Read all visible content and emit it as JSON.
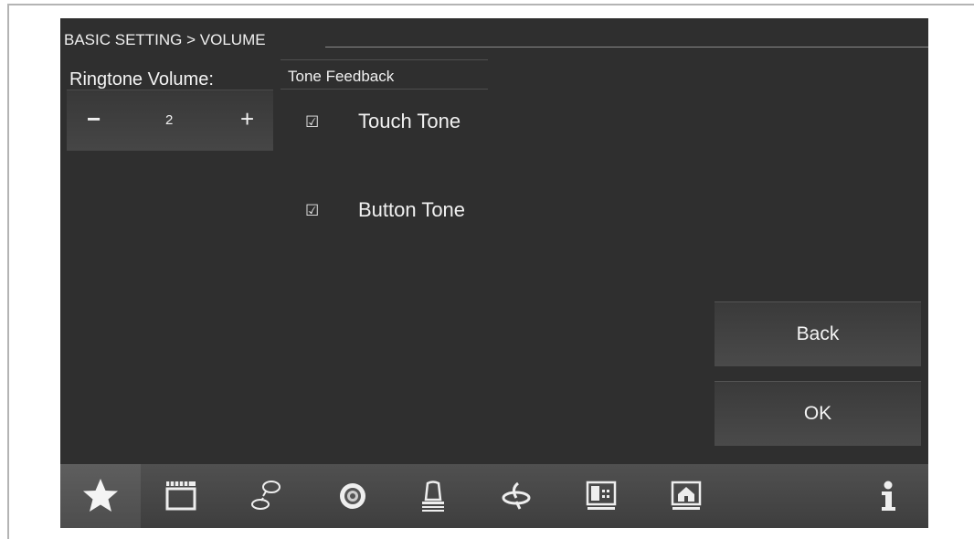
{
  "header": {
    "breadcrumb": "BASIC SETTING > VOLUME"
  },
  "ringtone": {
    "label": "Ringtone Volume:",
    "minus": "−",
    "plus": "+",
    "value": "2"
  },
  "tone_feedback": {
    "title": "Tone Feedback",
    "items": [
      {
        "label": "Touch Tone",
        "checked": true,
        "check_glyph": "☑"
      },
      {
        "label": "Button Tone",
        "checked": true,
        "check_glyph": "☑"
      }
    ]
  },
  "actions": {
    "back": "Back",
    "ok": "OK"
  },
  "taskbar": {
    "icons": [
      "star-icon",
      "clapperboard-icon",
      "chat-bubble-icon",
      "camera-lens-icon",
      "alarm-light-icon",
      "satellite-dish-icon",
      "building-panel-icon",
      "home-icon",
      "info-icon"
    ],
    "active_index": 0
  },
  "colors": {
    "screen_bg": "#2f2f2f",
    "text": "#f0f0f0",
    "taskbar_bg": "#484848"
  }
}
